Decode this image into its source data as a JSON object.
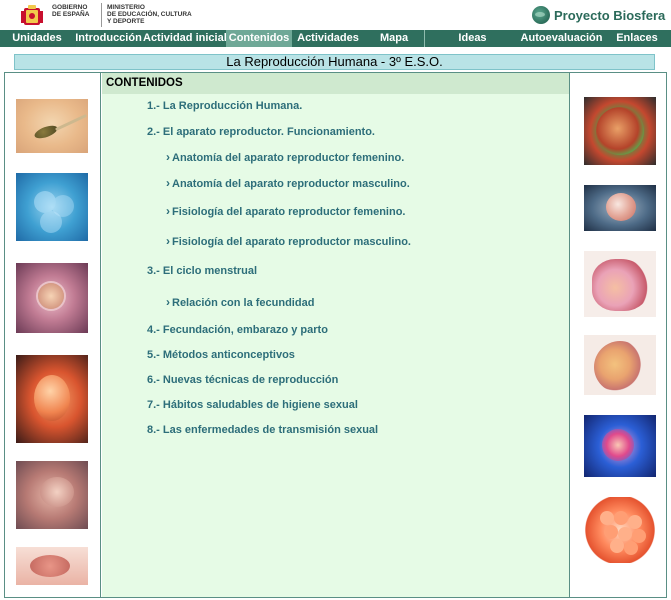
{
  "header": {
    "gov_line1": "GOBIERNO",
    "gov_line2": "DE ESPAÑA",
    "ministry_line1": "MINISTERIO",
    "ministry_line2": "DE EDUCACIÓN, CULTURA",
    "ministry_line3": "Y DEPORTE",
    "brand": "Proyecto Biosfera"
  },
  "nav": {
    "items": [
      {
        "label": "Unidades"
      },
      {
        "label": "Introducción"
      },
      {
        "label": "Actividad inicial"
      },
      {
        "label": "Contenidos"
      },
      {
        "label": "Actividades"
      },
      {
        "label": "Mapa"
      },
      {
        "label": "Ideas"
      },
      {
        "label": "Autoevaluación"
      },
      {
        "label": "Enlaces"
      }
    ],
    "active": "Contenidos"
  },
  "title": "La Reproducción Humana - 3º E.S.O.",
  "contenidos": {
    "heading": "CONTENIDOS",
    "items": [
      {
        "label": "1.- La Reproducción Humana."
      },
      {
        "label": "2.-  El aparato reproductor. Funcionamiento."
      },
      {
        "label": "Anatomía del aparato reproductor femenino."
      },
      {
        "label": "Anatomía del aparato reproductor masculino."
      },
      {
        "label": "Fisiología del aparato reproductor femenino."
      },
      {
        "label": "Fisiología del aparato reproductor masculino."
      },
      {
        "label": "3.-  El ciclo menstrual"
      },
      {
        "label": "Relación con la fecundidad"
      },
      {
        "label": "4.-  Fecundación, embarazo y parto"
      },
      {
        "label": "5.- Métodos anticonceptivos"
      },
      {
        "label": "6.- Nuevas técnicas de reproducción"
      },
      {
        "label": "7.- Hábitos saludables de higiene sexual"
      },
      {
        "label": "8.- Las enfermedades de transmisión sexual"
      }
    ]
  },
  "colors": {
    "nav_bg": "#2f6f5e",
    "nav_active": "#6fa897",
    "link": "#2d6e7a",
    "content_bg": "#e6fbe6",
    "title_bg": "#b9e3e6"
  }
}
